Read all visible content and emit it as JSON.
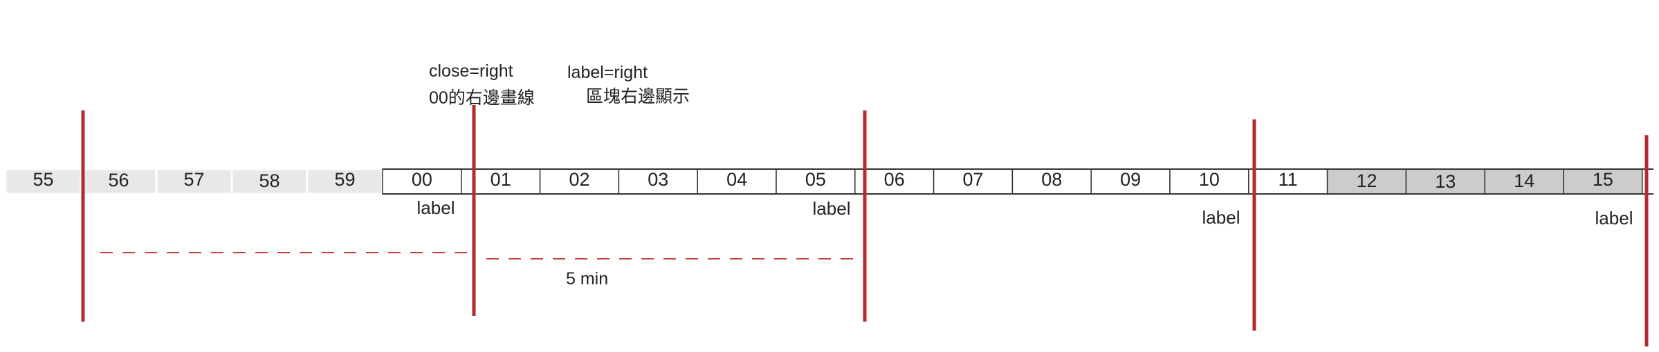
{
  "annotations": {
    "close_title": "close=right",
    "close_desc": "00的右邊畫線",
    "label_title": "label=right",
    "label_desc": "區塊右邊顯示"
  },
  "cells": [
    {
      "label": "55",
      "style": "light"
    },
    {
      "label": "56",
      "style": "light"
    },
    {
      "label": "57",
      "style": "light"
    },
    {
      "label": "58",
      "style": "light"
    },
    {
      "label": "59",
      "style": "light"
    },
    {
      "label": "00",
      "style": "white"
    },
    {
      "label": "01",
      "style": "white"
    },
    {
      "label": "02",
      "style": "white"
    },
    {
      "label": "03",
      "style": "white"
    },
    {
      "label": "04",
      "style": "white"
    },
    {
      "label": "05",
      "style": "white"
    },
    {
      "label": "06",
      "style": "white"
    },
    {
      "label": "07",
      "style": "white"
    },
    {
      "label": "08",
      "style": "white"
    },
    {
      "label": "09",
      "style": "white"
    },
    {
      "label": "10",
      "style": "white"
    },
    {
      "label": "11",
      "style": "white"
    },
    {
      "label": "12",
      "style": "gray"
    },
    {
      "label": "13",
      "style": "gray"
    },
    {
      "label": "14",
      "style": "gray"
    },
    {
      "label": "15",
      "style": "gray"
    }
  ],
  "boundaries": [
    {
      "label": ""
    },
    {
      "label": "label"
    },
    {
      "label": "label"
    },
    {
      "label": "label"
    },
    {
      "label": "label"
    }
  ],
  "interval_label": "5 min",
  "colors": {
    "boundary": "#b52b2b",
    "dashed": "#c84040",
    "cell_light": "#e8e8e8",
    "cell_gray": "#cccccc",
    "cell_white": "#ffffff",
    "cell_border": "#333333"
  }
}
